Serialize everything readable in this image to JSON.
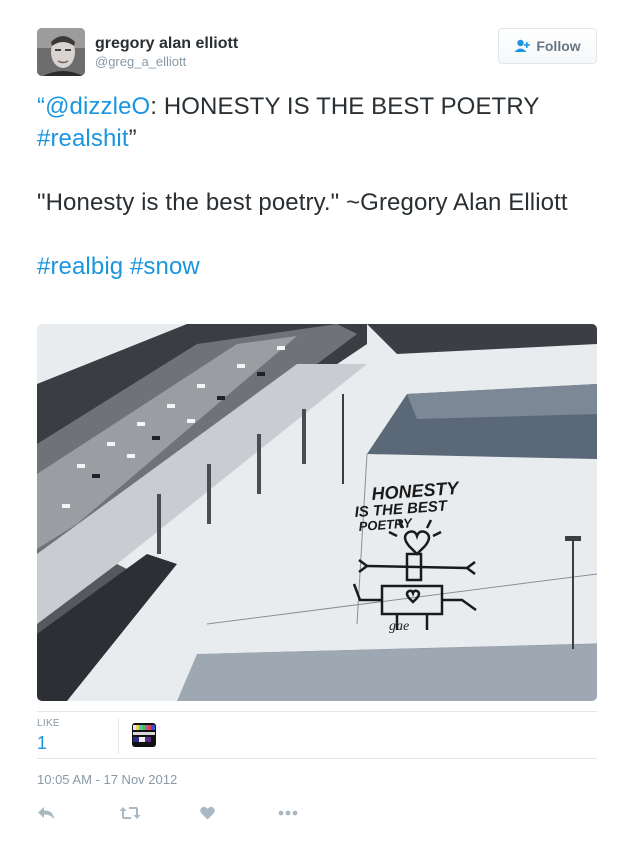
{
  "user": {
    "full_name": "gregory alan elliott",
    "screen_name": "@greg_a_elliott"
  },
  "follow_button": {
    "label": "Follow",
    "icon": "add-user-icon"
  },
  "tweet": {
    "quote_open": "“",
    "mention": "@dizzleO",
    "quote_body": ": HONESTY IS THE BEST POETRY ",
    "quote_hashtag": "#realshit",
    "quote_close": "”",
    "line2": "\"Honesty is the best poetry.\" ~Gregory Alan Elliott",
    "hashtag1": "#realbig",
    "hashtag2": "#snow"
  },
  "photo": {
    "snow_lettering": [
      "HONESTY",
      "IS THE BEST",
      "POETRY"
    ],
    "signature": "gae"
  },
  "stats": {
    "like_label": "LIKE",
    "like_count": "1"
  },
  "timestamp": "10:05 AM - 17 Nov 2012",
  "actions": [
    "reply-icon",
    "retweet-icon",
    "like-heart-icon",
    "more-icon"
  ],
  "colors": {
    "link": "#1b95e0",
    "text": "#292f33",
    "muted": "#8899a6",
    "border": "#e1e8ed",
    "action_icon": "#aab8c2"
  }
}
